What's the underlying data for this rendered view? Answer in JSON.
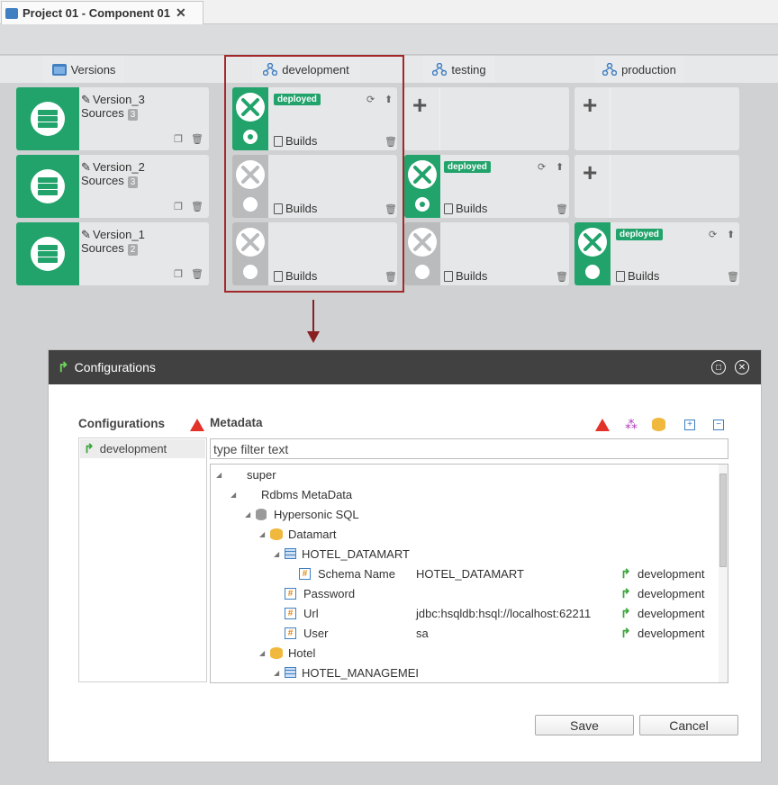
{
  "tab": {
    "title": "Project 01 - Component 01",
    "close": "✕"
  },
  "columns": {
    "versions": "Versions",
    "development": "development",
    "testing": "testing",
    "production": "production"
  },
  "versions": [
    {
      "title": "Version_3",
      "sources_label": "Sources",
      "sources_count": "3"
    },
    {
      "title": "Version_2",
      "sources_label": "Sources",
      "sources_count": "3"
    },
    {
      "title": "Version_1",
      "sources_label": "Sources",
      "sources_count": "2"
    }
  ],
  "env": {
    "deployed": "deployed",
    "builds": "Builds",
    "plus": "+"
  },
  "dialog": {
    "title": "Configurations",
    "configurations_header": "Configurations",
    "metadata_header": "Metadata",
    "config_item": "development",
    "filter_placeholder": "type filter text",
    "tree": [
      {
        "label": "super",
        "value": "",
        "cfg": ""
      },
      {
        "label": "Rdbms MetaData",
        "value": "",
        "cfg": ""
      },
      {
        "label": "Hypersonic SQL",
        "value": "",
        "cfg": ""
      },
      {
        "label": "Datamart",
        "value": "",
        "cfg": ""
      },
      {
        "label": "HOTEL_DATAMART",
        "value": "",
        "cfg": ""
      },
      {
        "label": "Schema Name",
        "value": "HOTEL_DATAMART",
        "cfg": "development"
      },
      {
        "label": "Password",
        "value": "",
        "cfg": "development"
      },
      {
        "label": "Url",
        "value": "jdbc:hsqldb:hsql://localhost:62211",
        "cfg": "development"
      },
      {
        "label": "User",
        "value": "sa",
        "cfg": "development"
      },
      {
        "label": "Hotel",
        "value": "",
        "cfg": ""
      },
      {
        "label": "HOTEL_MANAGEMEI",
        "value": "",
        "cfg": ""
      }
    ],
    "save": "Save",
    "cancel": "Cancel"
  },
  "colors": {
    "green": "#22a36b",
    "highlight": "#a3282b",
    "titlebar": "#414141"
  }
}
